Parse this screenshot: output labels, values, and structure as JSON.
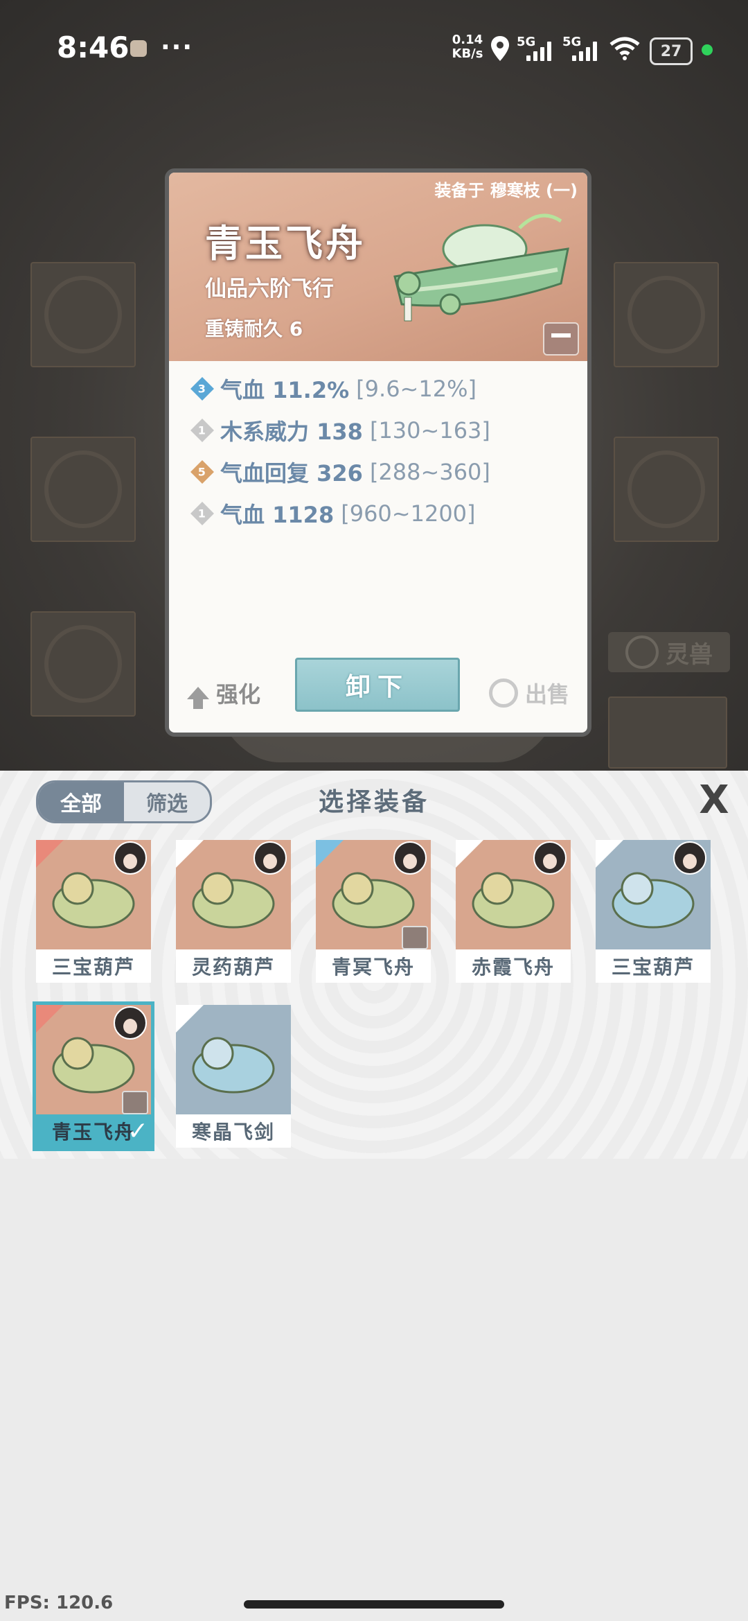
{
  "status_bar": {
    "time": "8:46",
    "dots": "···",
    "net_speed": "0.14",
    "net_unit": "KB/s",
    "sig1": "5G",
    "sig2": "5G",
    "battery": "27"
  },
  "background": {
    "spirit_button_label": "灵兽"
  },
  "detail_card": {
    "equipped_on": "装备于 穆寒枝 (一)",
    "name": "青玉飞舟",
    "type": "仙品六阶飞行",
    "durability": "重铸耐久 6",
    "stats": [
      {
        "badge": "3",
        "badge_color": "#5aa7d6",
        "name": "气血 11.2%",
        "range": "[9.6~12%]"
      },
      {
        "badge": "1",
        "badge_color": "#c8c8c8",
        "name": "木系威力 138",
        "range": "[130~163]"
      },
      {
        "badge": "5",
        "badge_color": "#d9a26a",
        "name": "气血回复 326",
        "range": "[288~360]"
      },
      {
        "badge": "1",
        "badge_color": "#c8c8c8",
        "name": "气血 1128",
        "range": "[960~1200]"
      }
    ],
    "upgrade_label": "强化",
    "unequip_label": "卸下",
    "sell_label": "出售"
  },
  "sheet": {
    "tab_all": "全部",
    "tab_filter": "筛选",
    "title": "选择装备",
    "close": "X",
    "items": [
      {
        "label": "三宝葫芦",
        "wing": "red",
        "avatar": true,
        "lock": false,
        "bg": "warm",
        "selected": false
      },
      {
        "label": "灵药葫芦",
        "wing": "white",
        "avatar": true,
        "lock": false,
        "bg": "warm",
        "selected": false
      },
      {
        "label": "青冥飞舟",
        "wing": "blue",
        "avatar": true,
        "lock": true,
        "bg": "warm",
        "selected": false
      },
      {
        "label": "赤霞飞舟",
        "wing": "white",
        "avatar": true,
        "lock": false,
        "bg": "warm",
        "selected": false
      },
      {
        "label": "三宝葫芦",
        "wing": "white",
        "avatar": true,
        "lock": false,
        "bg": "blue",
        "selected": false
      },
      {
        "label": "青玉飞舟",
        "wing": "red",
        "avatar": true,
        "lock": true,
        "bg": "warm",
        "selected": true
      },
      {
        "label": "寒晶飞剑",
        "wing": "white",
        "avatar": false,
        "lock": false,
        "bg": "blue",
        "selected": false
      }
    ]
  },
  "fps": "FPS: 120.6"
}
